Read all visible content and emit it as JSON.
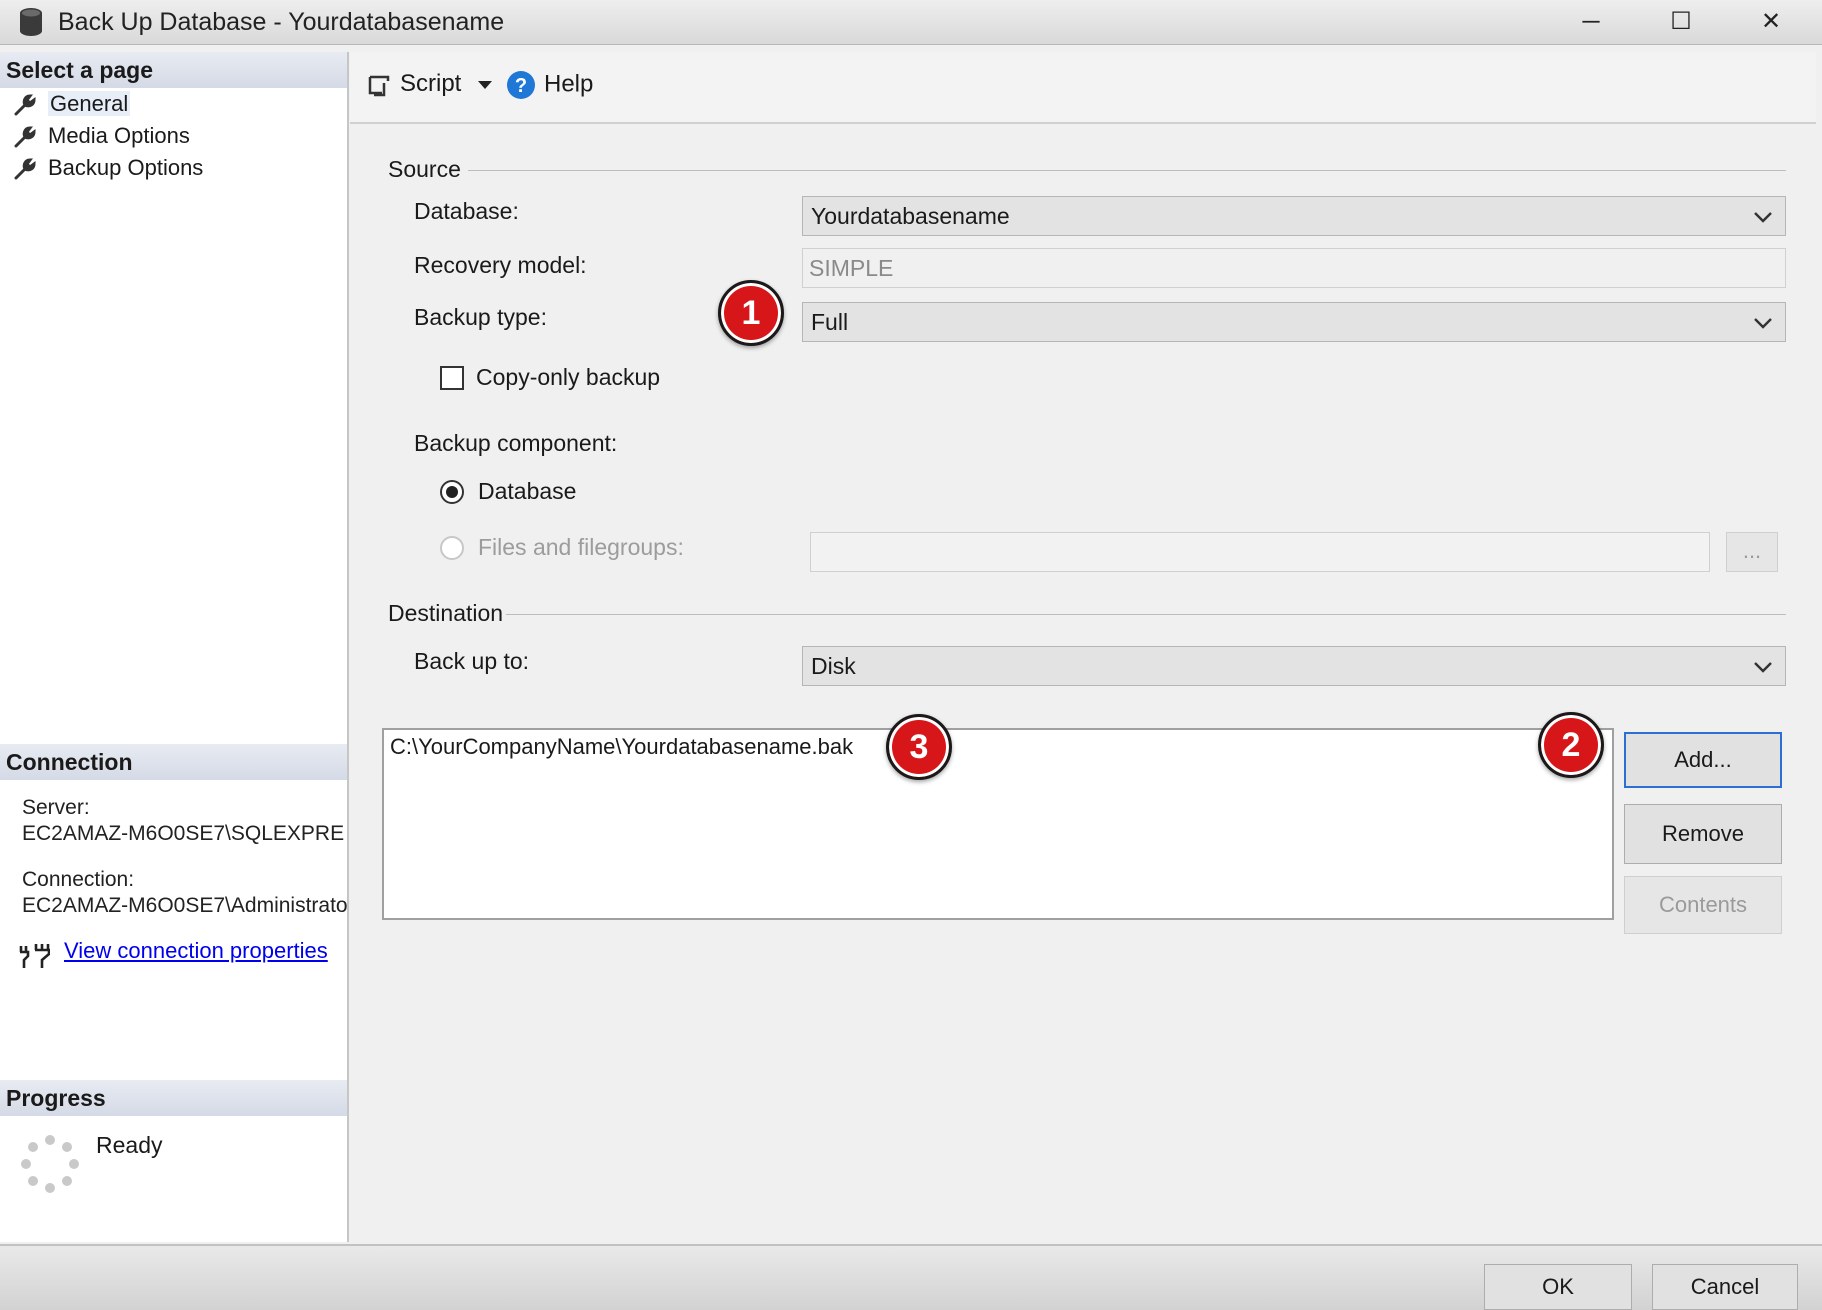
{
  "window": {
    "title": "Back Up Database - Yourdatabasename",
    "minimize_glyph": "─",
    "maximize_glyph": "☐",
    "close_glyph": "✕",
    "icon": "database-icon"
  },
  "sidebar": {
    "header": "Select a page",
    "pages": [
      {
        "label": "General",
        "icon": "wrench-icon",
        "selected": true
      },
      {
        "label": "Media Options",
        "icon": "wrench-icon",
        "selected": false
      },
      {
        "label": "Backup Options",
        "icon": "wrench-icon",
        "selected": false
      }
    ]
  },
  "connection": {
    "header": "Connection",
    "server_label": "Server:",
    "server_value": "EC2AMAZ-M6O0SE7\\SQLEXPRE",
    "connection_label": "Connection:",
    "connection_value": "EC2AMAZ-M6O0SE7\\Administrato",
    "link": "View connection properties",
    "link_icon": "connection-plug-icon"
  },
  "progress": {
    "header": "Progress",
    "status": "Ready",
    "icon": "spinner-icon"
  },
  "toolbar": {
    "script_label": "Script",
    "help_label": "Help",
    "script_icon": "script-icon",
    "help_icon": "help-icon"
  },
  "source": {
    "group_label": "Source",
    "database_label": "Database:",
    "database_value": "Yourdatabasename",
    "recovery_label": "Recovery model:",
    "recovery_value": "SIMPLE",
    "backup_type_label": "Backup type:",
    "backup_type_value": "Full",
    "copy_only_label": "Copy-only backup",
    "copy_only_checked": false,
    "component_label": "Backup component:",
    "component_database_label": "Database",
    "component_files_label": "Files and filegroups:",
    "files_browse_label": "...",
    "selected_component": "Database"
  },
  "destination": {
    "group_label": "Destination",
    "back_up_to_label": "Back up to:",
    "back_up_to_value": "Disk",
    "paths": [
      "C:\\YourCompanyName\\Yourdatabasename.bak"
    ],
    "add_label": "Add...",
    "remove_label": "Remove",
    "contents_label": "Contents"
  },
  "markers": [
    "1",
    "2",
    "3"
  ],
  "footer": {
    "ok_label": "OK",
    "cancel_label": "Cancel"
  },
  "colors": {
    "marker_fill": "#d7161a",
    "link": "#0000ee",
    "default_button_border": "#2a6fd1"
  }
}
